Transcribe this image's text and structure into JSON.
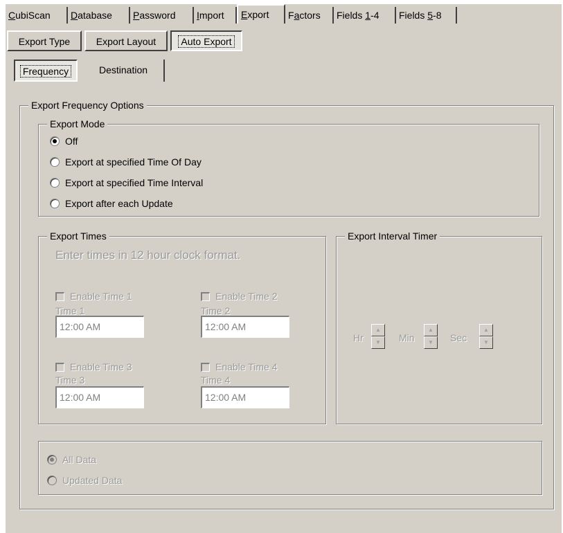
{
  "tabs": [
    {
      "label": "CubiScan",
      "mnemonic": "C"
    },
    {
      "label": "Database",
      "mnemonic": "D"
    },
    {
      "label": "Password",
      "mnemonic": "P"
    },
    {
      "label": "Import",
      "mnemonic": "I"
    },
    {
      "label": "Export",
      "mnemonic": "E"
    },
    {
      "label": "Factors",
      "mnemonic": "a"
    },
    {
      "label": "Fields 1-4",
      "mnemonic": "1"
    },
    {
      "label": "Fields 5-8",
      "mnemonic": "5"
    }
  ],
  "active_tab": "Export",
  "export_buttons": {
    "export_type": "Export Type",
    "export_layout": "Export Layout",
    "auto_export": "Auto Export"
  },
  "subtabs": {
    "frequency": "Frequency",
    "destination": "Destination"
  },
  "frequency_group": {
    "legend": "Export Frequency Options"
  },
  "export_mode": {
    "legend": "Export Mode",
    "options": [
      {
        "label": "Off",
        "checked": true
      },
      {
        "label": "Export at specified Time Of Day",
        "checked": false
      },
      {
        "label": "Export at specified Time Interval",
        "checked": false
      },
      {
        "label": "Export after each Update",
        "checked": false
      }
    ]
  },
  "export_times": {
    "legend": "Export Times",
    "hint": "Enter times in 12 hour clock format.",
    "slots": [
      {
        "enable_label": "Enable Time 1",
        "time_label": "Time 1",
        "value": "12:00 AM"
      },
      {
        "enable_label": "Enable Time 2",
        "time_label": "Time 2",
        "value": "12:00 AM"
      },
      {
        "enable_label": "Enable Time 3",
        "time_label": "Time 3",
        "value": "12:00 AM"
      },
      {
        "enable_label": "Enable Time 4",
        "time_label": "Time 4",
        "value": "12:00 AM"
      }
    ]
  },
  "interval_timer": {
    "legend": "Export Interval Timer",
    "hr_label": "Hr",
    "min_label": "Min",
    "sec_label": "Sec"
  },
  "data_scope": {
    "options": [
      {
        "label": "All Data",
        "checked": true
      },
      {
        "label": "Updated Data",
        "checked": false
      }
    ]
  },
  "icons": {
    "spin_up": "spin-up-arrow-icon",
    "spin_down": "spin-down-arrow-icon"
  }
}
